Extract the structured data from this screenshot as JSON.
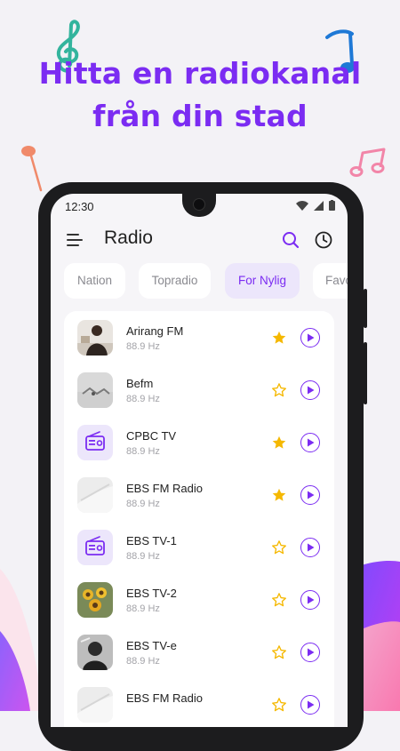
{
  "promo": {
    "line1": "Hitta en radiokanal",
    "line2": "från din stad"
  },
  "colors": {
    "accent": "#7b2cf2",
    "star": "#f5b800",
    "tab_active_bg": "#ece6fb"
  },
  "status_bar": {
    "time": "12:30"
  },
  "app_bar": {
    "title": "Radio",
    "menu_icon": "hamburger-menu-icon",
    "search_icon": "search-icon",
    "history_icon": "clock-history-icon"
  },
  "tabs": [
    {
      "label": "Nation",
      "active": false
    },
    {
      "label": "Topradio",
      "active": false
    },
    {
      "label": "For Nylig",
      "active": true
    },
    {
      "label": "Favo",
      "active": false
    }
  ],
  "stations": [
    {
      "name": "Arirang FM",
      "freq": "88.9 Hz",
      "favorite": true,
      "thumb": "photo-person"
    },
    {
      "name": "Befm",
      "freq": "88.9 Hz",
      "favorite": false,
      "thumb": "photo-grey"
    },
    {
      "name": "CPBC TV",
      "freq": "88.9 Hz",
      "favorite": true,
      "thumb": "radio-icon"
    },
    {
      "name": "EBS FM Radio",
      "freq": "88.9 Hz",
      "favorite": true,
      "thumb": "photo-light"
    },
    {
      "name": "EBS TV-1",
      "freq": "88.9 Hz",
      "favorite": false,
      "thumb": "radio-icon"
    },
    {
      "name": "EBS TV-2",
      "freq": "88.9 Hz",
      "favorite": false,
      "thumb": "photo-sunflowers"
    },
    {
      "name": "EBS TV-e",
      "freq": "88.9 Hz",
      "favorite": false,
      "thumb": "photo-bw-person"
    },
    {
      "name": "EBS FM Radio",
      "freq": "",
      "favorite": false,
      "thumb": "photo-light"
    }
  ]
}
